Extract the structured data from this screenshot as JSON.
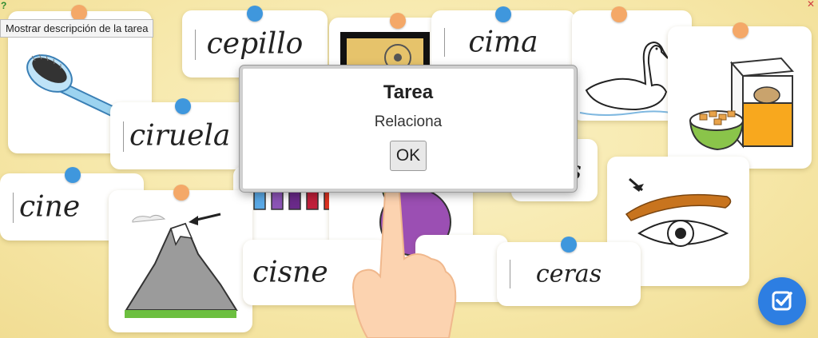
{
  "tooltip": {
    "text": "Mostrar descripción de la tarea"
  },
  "corner": {
    "help": "?",
    "close": "✕"
  },
  "dialog": {
    "title": "Tarea",
    "message": "Relaciona",
    "ok_label": "OK"
  },
  "cards": {
    "cepillo": "cepillo",
    "cima": "cima",
    "ciruela": "ciruela",
    "cine": "cine",
    "cisne": "cisne",
    "ceras": "ceras",
    "partial_word": "s"
  },
  "icons": {
    "fab": "check-square-icon",
    "hand": "pointing-hand-icon"
  },
  "colors": {
    "pin_blue": "#3f97dd",
    "pin_orange": "#f4a868",
    "fab": "#2d7ee2"
  }
}
